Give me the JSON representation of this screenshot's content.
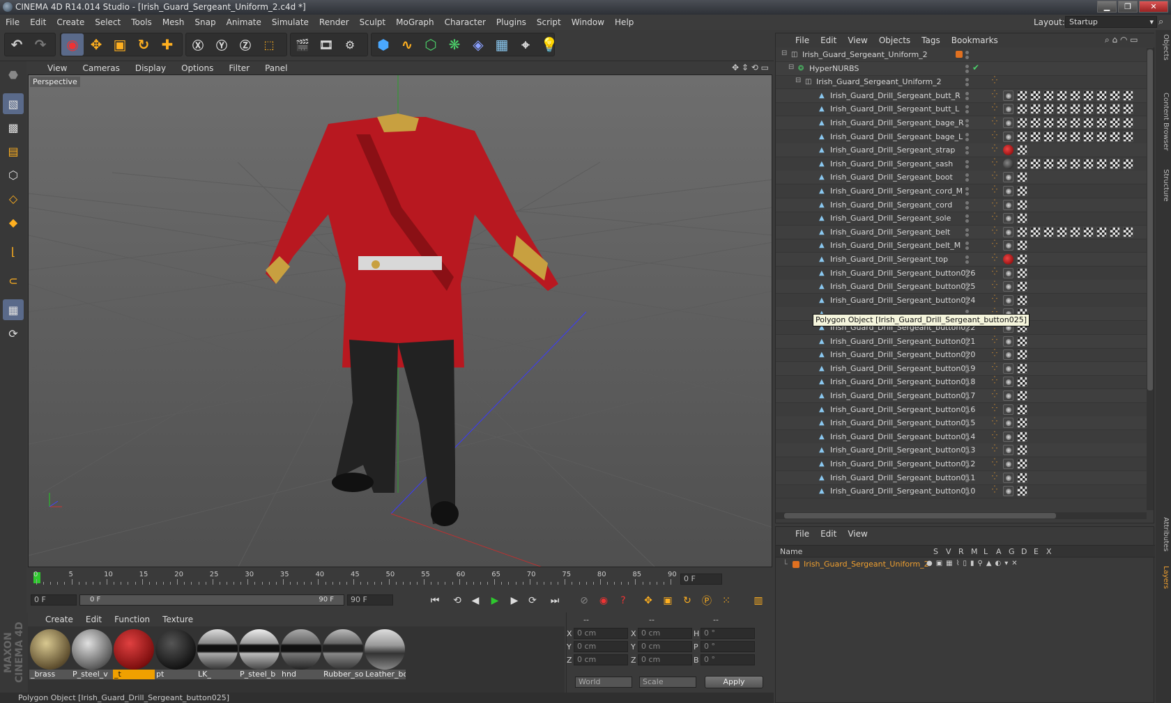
{
  "window": {
    "title": "CINEMA 4D R14.014 Studio - [Irish_Guard_Sergeant_Uniform_2.c4d *]",
    "minimize": "▁",
    "maximize": "❐",
    "close": "✕"
  },
  "menubar": [
    "File",
    "Edit",
    "Create",
    "Select",
    "Tools",
    "Mesh",
    "Snap",
    "Animate",
    "Simulate",
    "Render",
    "Sculpt",
    "MoGraph",
    "Character",
    "Plugins",
    "Script",
    "Window",
    "Help"
  ],
  "layout": {
    "label": "Layout:",
    "value": "Startup"
  },
  "viewport": {
    "menu": [
      "View",
      "Cameras",
      "Display",
      "Options",
      "Filter",
      "Panel"
    ],
    "label": "Perspective"
  },
  "timeline": {
    "ticks": [
      "0",
      "5",
      "10",
      "15",
      "20",
      "25",
      "30",
      "35",
      "40",
      "45",
      "50",
      "55",
      "60",
      "65",
      "70",
      "75",
      "80",
      "85",
      "90"
    ],
    "frame_display": "0 F"
  },
  "transport": {
    "start": "0 F",
    "range_start": "0 F",
    "range_end": "90 F",
    "end": "90 F"
  },
  "materials": {
    "menu": [
      "Create",
      "Edit",
      "Function",
      "Texture"
    ],
    "items": [
      {
        "label": "_brass"
      },
      {
        "label": "P_steel_v"
      },
      {
        "label": "_t"
      },
      {
        "label": "pt"
      },
      {
        "label": "LK_"
      },
      {
        "label": "P_steel_b"
      },
      {
        "label": "hnd"
      },
      {
        "label": "Rubber_so"
      },
      {
        "label": "Leather_bo"
      }
    ]
  },
  "coords": {
    "headers": [
      "--",
      "--",
      "--"
    ],
    "rows": [
      {
        "a": "X",
        "av": "0 cm",
        "b": "X",
        "bv": "0 cm",
        "c": "H",
        "cv": "0 °"
      },
      {
        "a": "Y",
        "av": "0 cm",
        "b": "Y",
        "bv": "0 cm",
        "c": "P",
        "cv": "0 °"
      },
      {
        "a": "Z",
        "av": "0 cm",
        "b": "Z",
        "bv": "0 cm",
        "c": "B",
        "cv": "0 °"
      }
    ],
    "space": "World",
    "mode": "Scale",
    "apply": "Apply"
  },
  "status": "Polygon Object [Irish_Guard_Drill_Sergeant_button025]",
  "maxon": "MAXON CINEMA 4D",
  "objects": {
    "menu": [
      "File",
      "Edit",
      "View",
      "Objects",
      "Tags",
      "Bookmarks"
    ],
    "rows": [
      {
        "name": "Irish_Guard_Sergeant_Uniform_2",
        "indent": 0,
        "icon": "null"
      },
      {
        "name": "HyperNURBS",
        "indent": 1,
        "icon": "nurbs"
      },
      {
        "name": "Irish_Guard_Sergeant_Uniform_2",
        "indent": 2,
        "icon": "null"
      },
      {
        "name": "Irish_Guard_Drill_Sergeant_butt_R",
        "indent": 3,
        "icon": "poly"
      },
      {
        "name": "Irish_Guard_Drill_Sergeant_butt_L",
        "indent": 3,
        "icon": "poly"
      },
      {
        "name": "Irish_Guard_Drill_Sergeant_bage_R",
        "indent": 3,
        "icon": "poly"
      },
      {
        "name": "Irish_Guard_Drill_Sergeant_bage_L",
        "indent": 3,
        "icon": "poly"
      },
      {
        "name": "Irish_Guard_Drill_Sergeant_strap",
        "indent": 3,
        "icon": "poly"
      },
      {
        "name": "Irish_Guard_Drill_Sergeant_sash",
        "indent": 3,
        "icon": "poly"
      },
      {
        "name": "Irish_Guard_Drill_Sergeant_boot",
        "indent": 3,
        "icon": "poly"
      },
      {
        "name": "Irish_Guard_Drill_Sergeant_cord_M",
        "indent": 3,
        "icon": "poly"
      },
      {
        "name": "Irish_Guard_Drill_Sergeant_cord",
        "indent": 3,
        "icon": "poly"
      },
      {
        "name": "Irish_Guard_Drill_Sergeant_sole",
        "indent": 3,
        "icon": "poly"
      },
      {
        "name": "Irish_Guard_Drill_Sergeant_belt",
        "indent": 3,
        "icon": "poly"
      },
      {
        "name": "Irish_Guard_Drill_Sergeant_belt_M",
        "indent": 3,
        "icon": "poly"
      },
      {
        "name": "Irish_Guard_Drill_Sergeant_top",
        "indent": 3,
        "icon": "poly"
      },
      {
        "name": "Irish_Guard_Drill_Sergeant_button026",
        "indent": 3,
        "icon": "poly"
      },
      {
        "name": "Irish_Guard_Drill_Sergeant_button025",
        "indent": 3,
        "icon": "poly"
      },
      {
        "name": "Irish_Guard_Drill_Sergeant_button024",
        "indent": 3,
        "icon": "poly"
      },
      {
        "name": "",
        "indent": 3,
        "icon": "poly"
      },
      {
        "name": "Irish_Guard_Drill_Sergeant_button022",
        "indent": 3,
        "icon": "poly"
      },
      {
        "name": "Irish_Guard_Drill_Sergeant_button021",
        "indent": 3,
        "icon": "poly"
      },
      {
        "name": "Irish_Guard_Drill_Sergeant_button020",
        "indent": 3,
        "icon": "poly"
      },
      {
        "name": "Irish_Guard_Drill_Sergeant_button019",
        "indent": 3,
        "icon": "poly"
      },
      {
        "name": "Irish_Guard_Drill_Sergeant_button018",
        "indent": 3,
        "icon": "poly"
      },
      {
        "name": "Irish_Guard_Drill_Sergeant_button017",
        "indent": 3,
        "icon": "poly"
      },
      {
        "name": "Irish_Guard_Drill_Sergeant_button016",
        "indent": 3,
        "icon": "poly"
      },
      {
        "name": "Irish_Guard_Drill_Sergeant_button015",
        "indent": 3,
        "icon": "poly"
      },
      {
        "name": "Irish_Guard_Drill_Sergeant_button014",
        "indent": 3,
        "icon": "poly"
      },
      {
        "name": "Irish_Guard_Drill_Sergeant_button013",
        "indent": 3,
        "icon": "poly"
      },
      {
        "name": "Irish_Guard_Drill_Sergeant_button012",
        "indent": 3,
        "icon": "poly"
      },
      {
        "name": "Irish_Guard_Drill_Sergeant_button011",
        "indent": 3,
        "icon": "poly"
      },
      {
        "name": "Irish_Guard_Drill_Sergeant_button010",
        "indent": 3,
        "icon": "poly"
      }
    ],
    "tooltip": "Polygon Object [Irish_Guard_Drill_Sergeant_button025]"
  },
  "layers": {
    "menu": [
      "File",
      "Edit",
      "View"
    ],
    "columns": [
      "Name",
      "S",
      "V",
      "R",
      "M",
      "L",
      "A",
      "G",
      "D",
      "E",
      "X"
    ],
    "row_name": "Irish_Guard_Sergeant_Uniform_2",
    "row_color": "#e07020"
  },
  "side_tabs": [
    "Objects",
    "Content Browser",
    "Structure",
    "Attributes",
    "Layers"
  ]
}
